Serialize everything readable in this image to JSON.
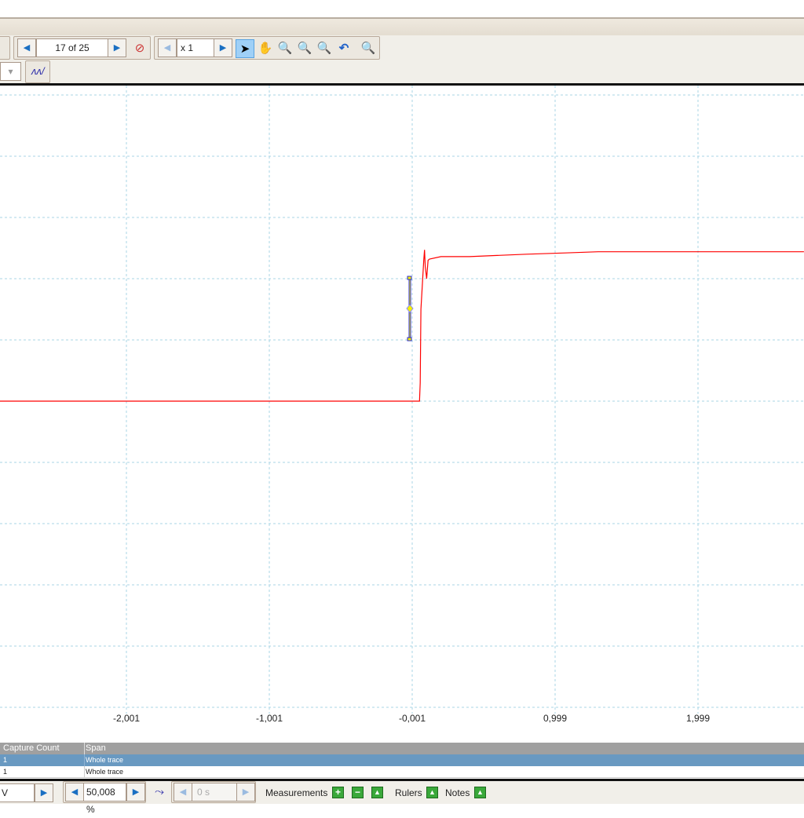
{
  "toolbar": {
    "buffer_value": "17 of 25",
    "zoom_value": "x 1",
    "tools": [
      "select-arrow-icon",
      "hand-pan-icon",
      "zoom-area-icon",
      "zoom-in-icon",
      "zoom-out-icon",
      "undo-zoom-icon",
      "zoom-overview-icon"
    ],
    "active_tool": "select-arrow-icon"
  },
  "table": {
    "headers": [
      "Capture Count",
      "Span"
    ],
    "rows": [
      {
        "count": "1",
        "span": "Whole trace",
        "selected": true
      },
      {
        "count": "1",
        "span": "Whole trace",
        "selected": false
      }
    ]
  },
  "bottombar": {
    "range_value": "V",
    "offset_value": "50,008 %",
    "delay_value": "0 s",
    "measurements_label": "Measurements",
    "rulers_label": "Rulers",
    "notes_label": "Notes"
  },
  "chart_data": {
    "type": "line",
    "x_ticks": [
      "-2,001",
      "-1,001",
      "-0,001",
      "0,999",
      "1,999"
    ],
    "x_tick_values": [
      -2.001,
      -1.001,
      -0.001,
      0.999,
      1.999
    ],
    "xlim": [
      -2.89,
      2.74
    ],
    "ylim": [
      -5,
      5.6
    ],
    "grid": true,
    "trace_color": "#ff0000",
    "grid_color": "#a9d6e6",
    "series": [
      {
        "x": [
          -2.89,
          0.05,
          0.055,
          0.06,
          0.08,
          0.085,
          0.09,
          0.1,
          0.11,
          0.12,
          0.2,
          0.4,
          0.8,
          1.07,
          1.3,
          2.74
        ],
        "y": [
          0,
          0,
          0.3,
          1.5,
          2.3,
          2.47,
          2.2,
          2.0,
          2.3,
          2.32,
          2.36,
          2.36,
          2.4,
          2.42,
          2.44,
          2.44
        ]
      }
    ]
  }
}
